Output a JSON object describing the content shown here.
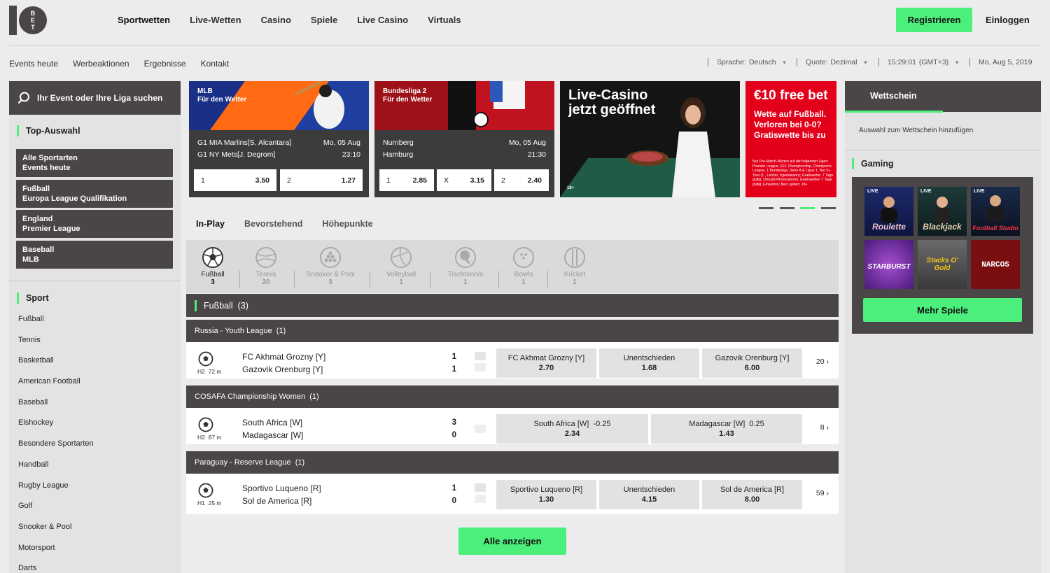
{
  "header": {
    "logo_text": "10BET",
    "nav": [
      "Sportwetten",
      "Live-Wetten",
      "Casino",
      "Spiele",
      "Live Casino",
      "Virtuals"
    ],
    "register_label": "Registrieren",
    "login_label": "Einloggen"
  },
  "subnav": [
    "Events heute",
    "Werbeaktionen",
    "Ergebnisse",
    "Kontakt"
  ],
  "meta": {
    "language_label": "Sprache:",
    "language_value": "Deutsch",
    "odds_label": "Quote:",
    "odds_value": "Dezimal",
    "time": "15:29:01",
    "timezone": "(GMT+3)",
    "date": "Mo, Aug 5, 2019"
  },
  "sidebar": {
    "search_placeholder": "Ihr Event oder Ihre Liga suchen",
    "top_title": "Top-Auswahl",
    "top_items": [
      {
        "line1": "Alle Sportarten",
        "line2": "Events heute"
      },
      {
        "line1": "Fußball",
        "line2": "Europa League Qualifikation"
      },
      {
        "line1": "England",
        "line2": "Premier League"
      },
      {
        "line1": "Baseball",
        "line2": "MLB"
      }
    ],
    "sport_title": "Sport",
    "sports": [
      "Fußball",
      "Tennis",
      "Basketball",
      "American Football",
      "Baseball",
      "Eishockey",
      "Besondere Sportarten",
      "Handball",
      "Rugby League",
      "Golf",
      "Snooker & Pool",
      "Motorsport",
      "Darts"
    ]
  },
  "banners": [
    {
      "title1": "MLB",
      "title2": "Für den Wetter",
      "team1": "G1 MIA Marlins[S. Alcantara]",
      "team2": "G1 NY Mets[J. Degrom]",
      "date": "Mo, 05 Aug",
      "time": "23:10",
      "odds": [
        {
          "label": "1",
          "value": "3.50"
        },
        {
          "label": "2",
          "value": "1.27"
        }
      ]
    },
    {
      "title1": "Bundesliga 2",
      "title2": "Für den Wetter",
      "team1": "Nurnberg",
      "team2": "Hamburg",
      "date": "Mo, 05 Aug",
      "time": "21:30",
      "odds": [
        {
          "label": "1",
          "value": "2.85"
        },
        {
          "label": "X",
          "value": "3.15"
        },
        {
          "label": "2",
          "value": "2.40"
        }
      ]
    },
    {
      "title1": "Live-Casino",
      "title2": "jetzt geöffnet",
      "age": "18+"
    },
    {
      "title": "€10 free bet",
      "sub1": "Wette auf Fußball.",
      "sub2": "Verloren bei 0-0?",
      "sub3": "Gratiswette bis zu",
      "fine": "Nur Pre-Match-Wetten auf die folgenden Ligen: Premier League, EFL Championship, Champions League, 1.Bundesliga, Serie A & Ligue 1; Nur 5+ Tore (1., Letzter, Irgendwann); Gratiswette: 7 Tage gültig; Umsatz=Bonusstorno; Gratiswetten 7 Tage gültig; Einsatzes; Bed. gelten; 18+"
    }
  ],
  "tabs": [
    "In-Play",
    "Bevorstehend",
    "Höhepunkte"
  ],
  "sport_icons": [
    {
      "name": "Fußball",
      "count": "3",
      "icon": "soccer-ball-icon"
    },
    {
      "name": "Tennis",
      "count": "20",
      "icon": "tennis-ball-icon"
    },
    {
      "name": "Snooker & Pool",
      "count": "3",
      "icon": "snooker-icon"
    },
    {
      "name": "Volleyball",
      "count": "1",
      "icon": "volleyball-icon"
    },
    {
      "name": "Tischtennis",
      "count": "1",
      "icon": "table-tennis-icon"
    },
    {
      "name": "Bowls",
      "count": "1",
      "icon": "bowls-icon"
    },
    {
      "name": "Kricket",
      "count": "1",
      "icon": "cricket-icon"
    }
  ],
  "sport_header": "Fußball  (3)",
  "leagues": [
    {
      "name": "Russia - Youth League  (1)",
      "event": {
        "time": "H2  72 m",
        "team1": "FC Akhmat Grozny [Y]",
        "team2": "Gazovik Orenburg [Y]",
        "score1": "1",
        "score2": "1",
        "odds": [
          {
            "label": "FC Akhmat Grozny [Y]",
            "value": "2.70"
          },
          {
            "label": "Unentschieden",
            "value": "1.68"
          },
          {
            "label": "Gazovik Orenburg [Y]",
            "value": "6.00"
          }
        ],
        "more": "20"
      }
    },
    {
      "name": "COSAFA Championship Women  (1)",
      "event": {
        "time": "H2  87 m",
        "team1": "South Africa [W]",
        "team2": "Madagascar [W]",
        "score1": "3",
        "score2": "0",
        "odds": [
          {
            "label": "South Africa [W]  -0.25",
            "value": "2.34"
          },
          {
            "label": "Madagascar [W]  0.25",
            "value": "1.43"
          }
        ],
        "more": "8"
      }
    },
    {
      "name": "Paraguay - Reserve League  (1)",
      "event": {
        "time": "H1  25 m",
        "team1": "Sportivo Luqueno [R]",
        "team2": "Sol de America [R]",
        "score1": "1",
        "score2": "0",
        "odds": [
          {
            "label": "Sportivo Luqueno [R]",
            "value": "1.30"
          },
          {
            "label": "Unentschieden",
            "value": "4.15"
          },
          {
            "label": "Sol de America [R]",
            "value": "8.00"
          }
        ],
        "more": "59"
      }
    }
  ],
  "show_all_label": "Alle anzeigen",
  "betslip": {
    "title": "Wettschein",
    "empty_text": "Auswahl zum Wettschein hinzufügen",
    "gaming_title": "Gaming",
    "games": [
      {
        "name": "Roulette",
        "badge": "LIVE"
      },
      {
        "name": "Blackjack",
        "badge": "LIVE"
      },
      {
        "name": "Football Studio",
        "badge": "LIVE"
      },
      {
        "name": "STARBURST",
        "badge": ""
      },
      {
        "name": "Stacks O' Gold",
        "badge": ""
      },
      {
        "name": "NARCOS",
        "badge": ""
      }
    ],
    "more_games_label": "Mehr Spiele"
  },
  "colors": {
    "accent": "#4cef7c",
    "dark": "#4a4546",
    "background": "#ececec"
  }
}
